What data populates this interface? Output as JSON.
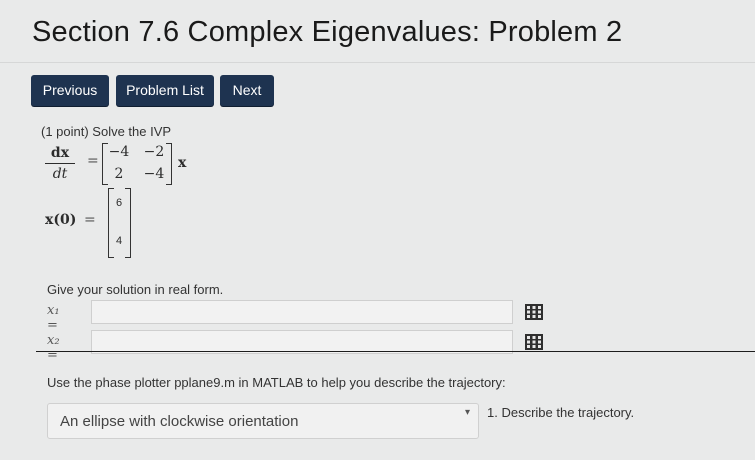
{
  "page": {
    "title": "Section 7.6 Complex Eigenvalues: Problem 2"
  },
  "nav": {
    "previous": "Previous",
    "problem_list": "Problem List",
    "next": "Next"
  },
  "problem": {
    "points": "(1 point) Solve the IVP",
    "derivative_num": "dx",
    "derivative_den": "dt",
    "equals": "=",
    "matrix": [
      [
        "−4",
        "−2"
      ],
      [
        "2",
        "−4"
      ]
    ],
    "vector_symbol": "x",
    "initial_label": "x(0)",
    "initial_vector": [
      "6",
      "4"
    ]
  },
  "answer": {
    "instructions": "Give your solution in real form.",
    "rows": [
      {
        "label": "x₁ =",
        "value": ""
      },
      {
        "label": "x₂ =",
        "value": ""
      }
    ],
    "grid_icon": "matrix-grid-icon"
  },
  "trajectory": {
    "question": "Use the phase plotter pplane9.m in MATLAB to help you describe the trajectory:",
    "selected": "An ellipse with clockwise orientation",
    "caret": "▾",
    "label": "1. Describe the trajectory."
  },
  "colors": {
    "button_bg": "#1e3350",
    "page_bg": "#e9eaea"
  }
}
